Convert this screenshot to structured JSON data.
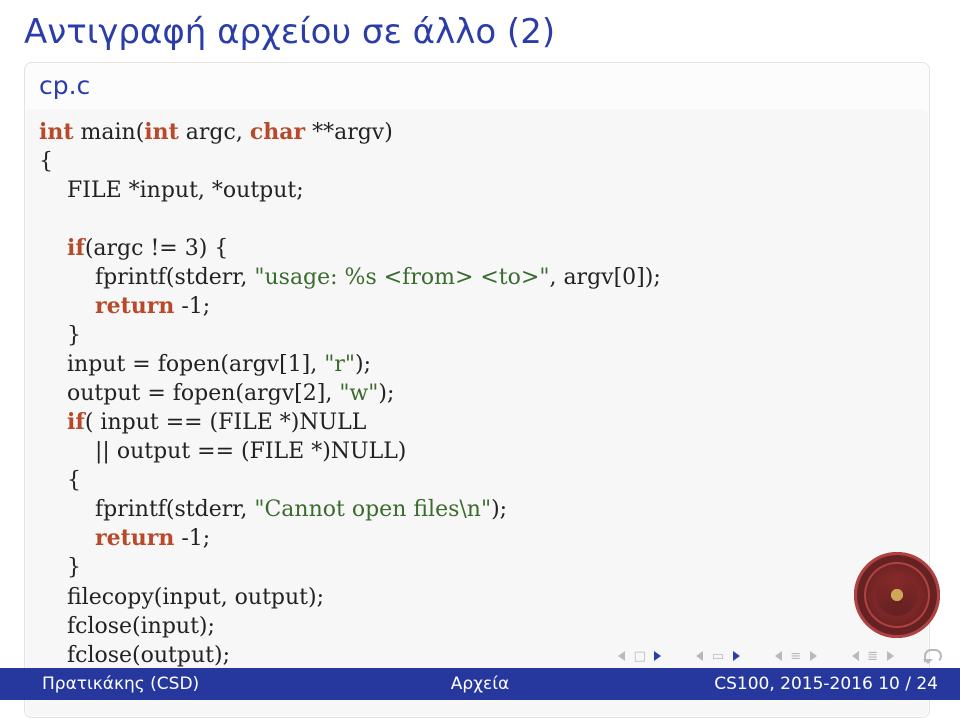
{
  "title": "Αντιγραφή αρχείου σε άλλο (2)",
  "block_title": "cp.c",
  "code": {
    "kw_int1": "int",
    "t_main": " main(",
    "kw_int2": "int",
    "t_argc": " argc, ",
    "kw_char": "char",
    "t_argv": " **argv)",
    "t_ob": "{",
    "t_decl": "FILE *input, *output;",
    "kw_if1": "if",
    "t_ifcond": "(argc != 3) {",
    "t_fpr1a": "fprintf(stderr, ",
    "str_usage": "\"usage: %s <from> <to>\"",
    "t_fpr1b": ", argv[0]);",
    "kw_ret1": "return",
    "t_ret1": " -1;",
    "t_cb1": "}",
    "t_in": "input = fopen(argv[1], ",
    "str_r": "\"r\"",
    "t_in2": ");",
    "t_out": "output = fopen(argv[2], ",
    "str_w": "\"w\"",
    "t_out2": ");",
    "kw_if2": "if",
    "t_if2": "( input == (FILE *)NULL",
    "t_if2b": "|| output == (FILE *)NULL)",
    "t_ob2": "{",
    "t_fpr2a": "fprintf(stderr, ",
    "str_cant": "\"Cannot open files\\n\"",
    "t_fpr2b": ");",
    "kw_ret2": "return",
    "t_ret2": " -1;",
    "t_cb2": "}",
    "t_fc": "filecopy(input, output);",
    "t_cl1": "fclose(input);",
    "t_cl2": "fclose(output);",
    "t_cb3": "}"
  },
  "footer": {
    "left": "Πρατικάκης (CSD)",
    "center": "Αρχεία",
    "right": "CS100, 2015-2016     10 / 24"
  }
}
